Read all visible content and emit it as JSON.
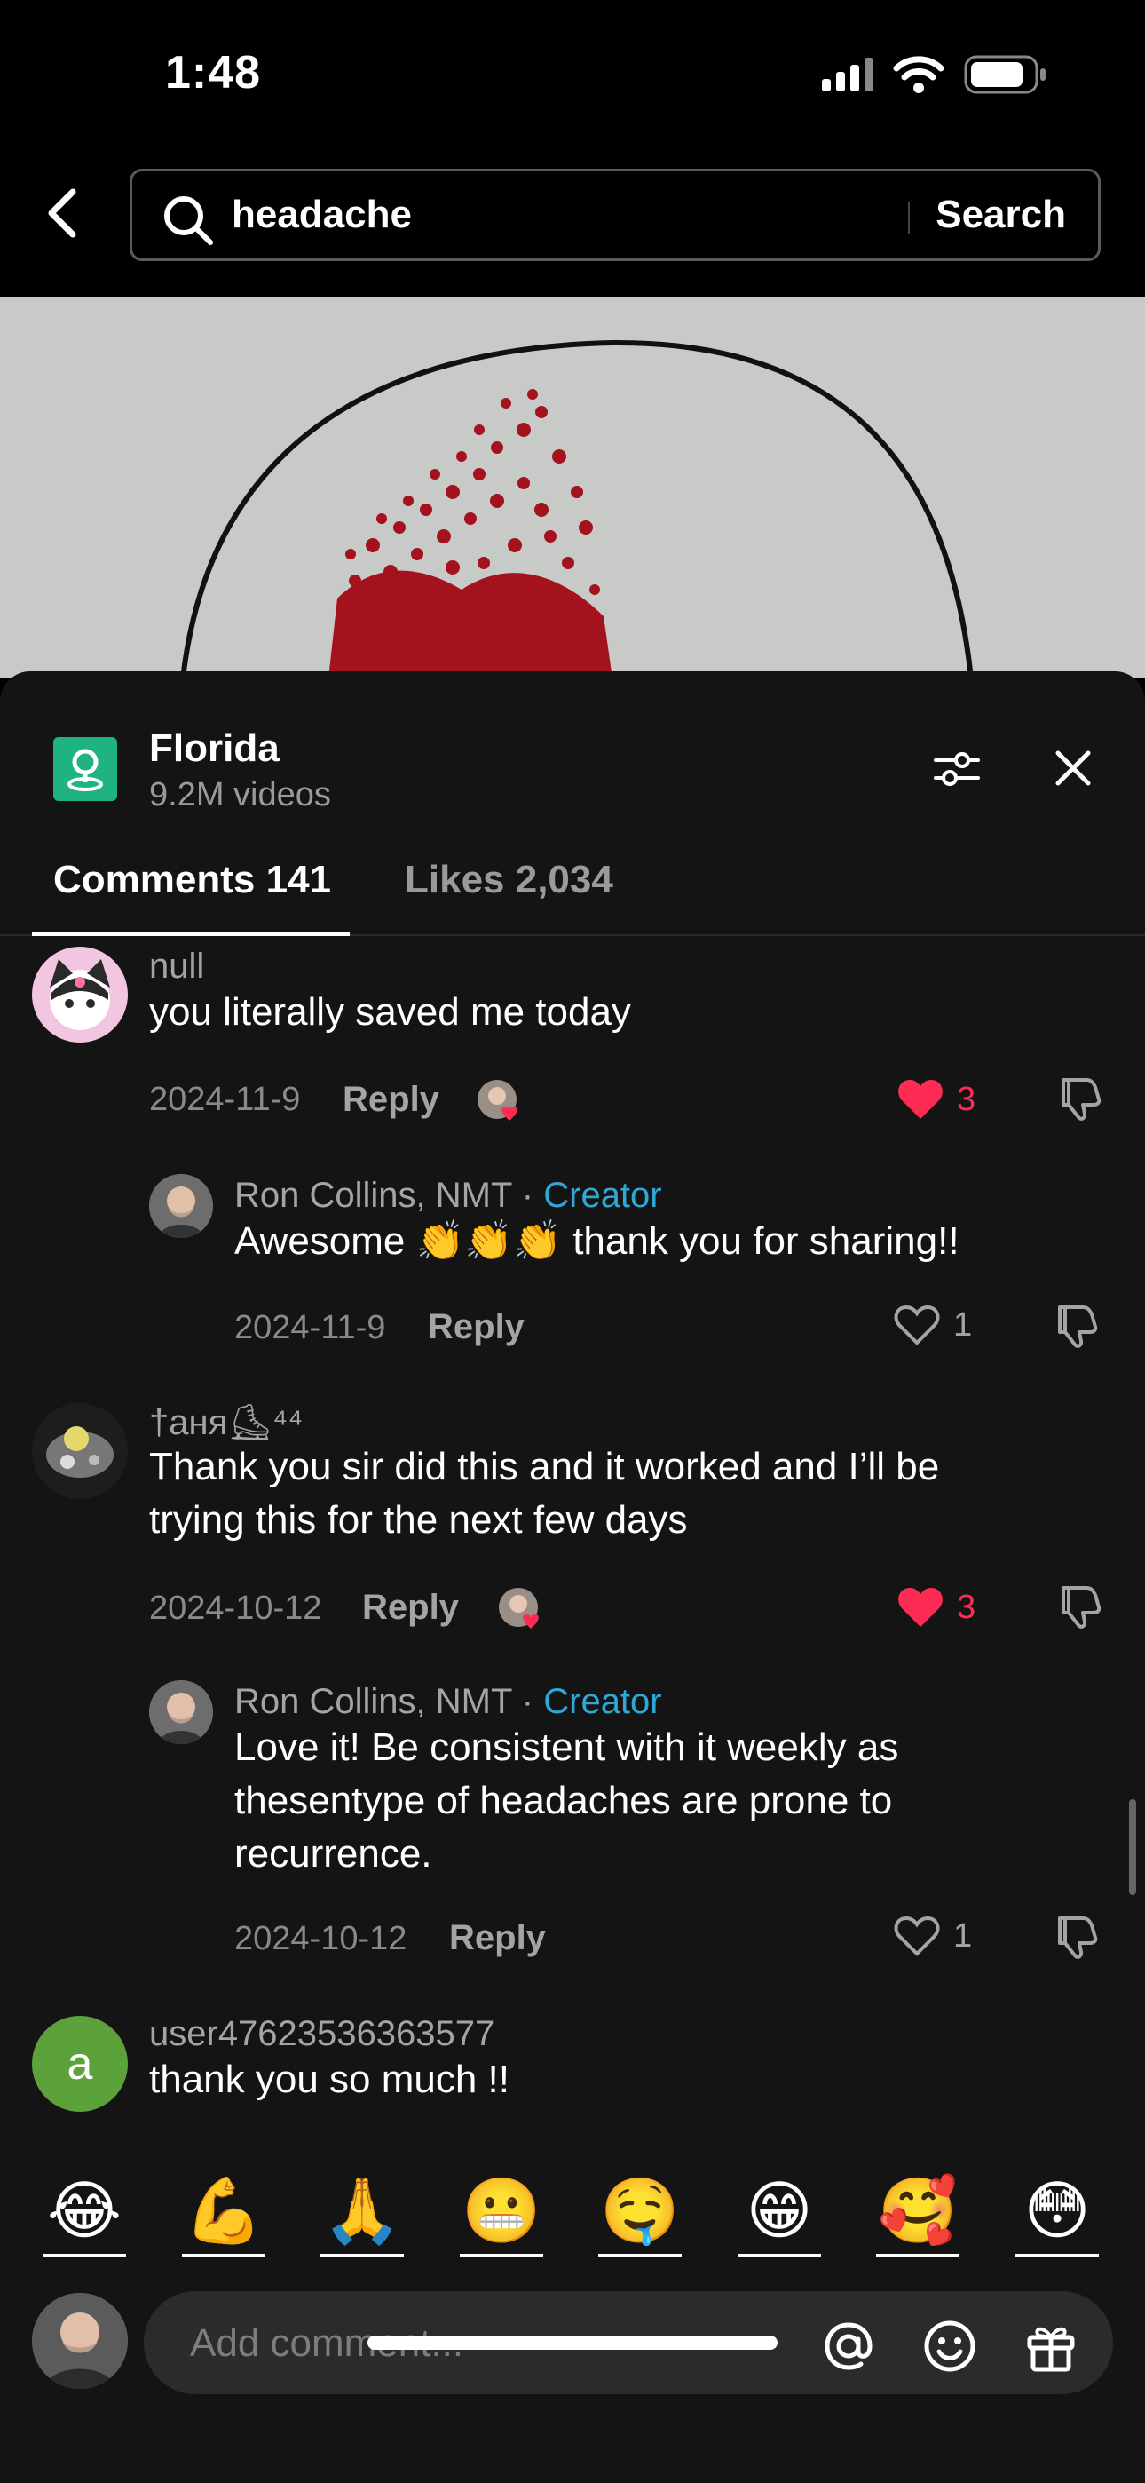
{
  "status_bar": {
    "time": "1:48"
  },
  "search": {
    "query": "headache",
    "button_label": "Search"
  },
  "place": {
    "name": "Florida",
    "count": "9.2M videos"
  },
  "tabs": {
    "comments": "Comments 141",
    "likes": "Likes 2,034"
  },
  "comments": [
    {
      "user": "null",
      "text": "you literally saved me today",
      "date": "2024-11-9",
      "reply_label": "Reply",
      "likes": "3",
      "liked": true,
      "replies": [
        {
          "user": "Ron Collins, NMT",
          "separator": " · ",
          "tag": "Creator",
          "text": "Awesome 👏👏👏 thank you for sharing!!",
          "date": "2024-11-9",
          "reply_label": "Reply",
          "likes": "1",
          "liked": false
        }
      ]
    },
    {
      "user": "†аня⛸⁴⁴",
      "text_lines": [
        "Thank you sir did this and it worked and I’ll be",
        "trying this for the next few days"
      ],
      "date": "2024-10-12",
      "reply_label": "Reply",
      "likes": "3",
      "liked": true,
      "replies": [
        {
          "user": "Ron Collins, NMT",
          "separator": " · ",
          "tag": "Creator",
          "text_lines": [
            "Love it! Be consistent with it weekly as",
            "thesentype of headaches are prone to",
            "recurrence."
          ],
          "date": "2024-10-12",
          "reply_label": "Reply",
          "likes": "1",
          "liked": false
        }
      ]
    },
    {
      "user": "user47623536363577",
      "avatar_letter": "a",
      "text": "thank you so much !!"
    }
  ],
  "emoji_bar": [
    "😂",
    "💪",
    "🙏",
    "😬",
    "🤤",
    "😁",
    "🥰",
    "😳"
  ],
  "composer": {
    "placeholder": "Add comment..."
  },
  "colors": {
    "like_red": "#fe2c55",
    "creator_blue": "#2fa8d6",
    "place_green": "#1fb384"
  }
}
